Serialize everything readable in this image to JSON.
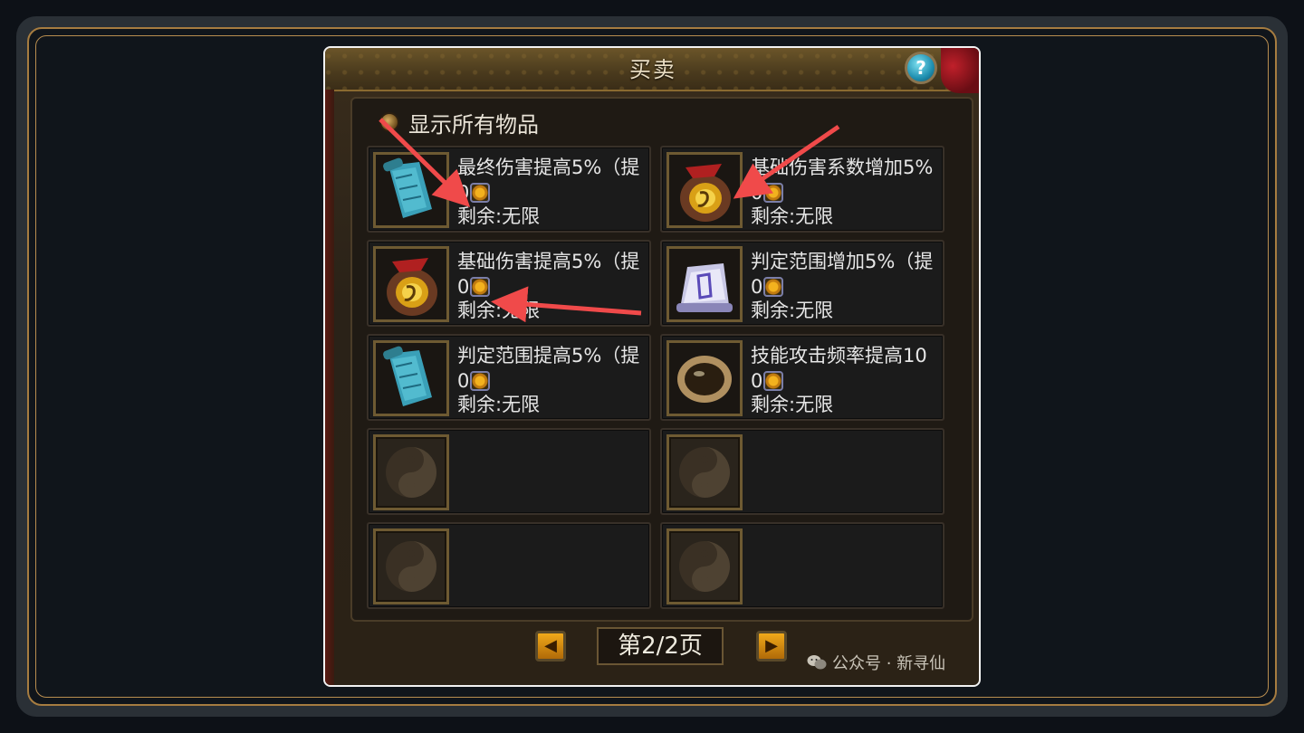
{
  "window": {
    "title": "买卖",
    "help_label": "?"
  },
  "filter": {
    "label": "显示所有物品"
  },
  "items": [
    {
      "name": "最终伤害提高5%（提",
      "price": "0",
      "remaining": "剩余:无限",
      "icon": "blue-scroll-icon"
    },
    {
      "name": "基础伤害系数增加5%",
      "price": "0",
      "remaining": "剩余:无限",
      "icon": "gold-pouch-icon"
    },
    {
      "name": "基础伤害提高5%（提",
      "price": "0",
      "remaining": "剩余:无限",
      "icon": "gold-pouch-icon"
    },
    {
      "name": "判定范围增加5%（提",
      "price": "0",
      "remaining": "剩余:无限",
      "icon": "purple-scroll-icon"
    },
    {
      "name": "判定范围提高5%（提",
      "price": "0",
      "remaining": "剩余:无限",
      "icon": "blue-scroll-icon"
    },
    {
      "name": "技能攻击频率提高10",
      "price": "0",
      "remaining": "剩余:无限",
      "icon": "gold-ring-icon"
    }
  ],
  "empty_slots": 4,
  "pager": {
    "prev_label": "◀",
    "next_label": "▶",
    "page_label": "第2/2页"
  },
  "watermark": {
    "text": "公众号 · 新寻仙"
  },
  "colors": {
    "annotation_arrow": "#f04a4a",
    "frame_gold": "#a67c40"
  }
}
